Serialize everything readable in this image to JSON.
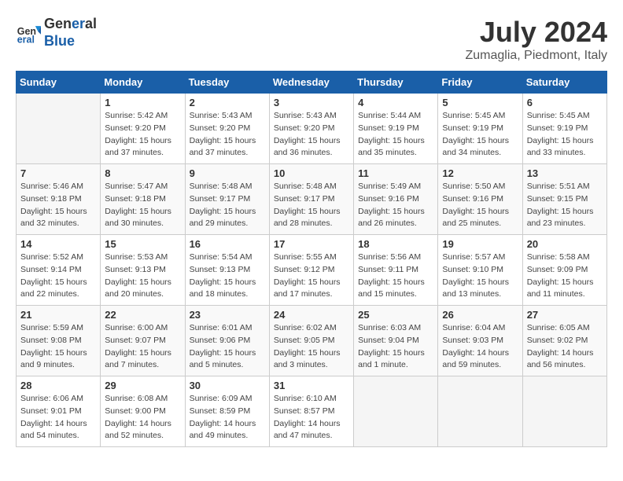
{
  "header": {
    "logo_line1": "General",
    "logo_line2": "Blue",
    "month_year": "July 2024",
    "location": "Zumaglia, Piedmont, Italy"
  },
  "weekdays": [
    "Sunday",
    "Monday",
    "Tuesday",
    "Wednesday",
    "Thursday",
    "Friday",
    "Saturday"
  ],
  "weeks": [
    [
      {
        "day": "",
        "info": ""
      },
      {
        "day": "1",
        "info": "Sunrise: 5:42 AM\nSunset: 9:20 PM\nDaylight: 15 hours\nand 37 minutes."
      },
      {
        "day": "2",
        "info": "Sunrise: 5:43 AM\nSunset: 9:20 PM\nDaylight: 15 hours\nand 37 minutes."
      },
      {
        "day": "3",
        "info": "Sunrise: 5:43 AM\nSunset: 9:20 PM\nDaylight: 15 hours\nand 36 minutes."
      },
      {
        "day": "4",
        "info": "Sunrise: 5:44 AM\nSunset: 9:19 PM\nDaylight: 15 hours\nand 35 minutes."
      },
      {
        "day": "5",
        "info": "Sunrise: 5:45 AM\nSunset: 9:19 PM\nDaylight: 15 hours\nand 34 minutes."
      },
      {
        "day": "6",
        "info": "Sunrise: 5:45 AM\nSunset: 9:19 PM\nDaylight: 15 hours\nand 33 minutes."
      }
    ],
    [
      {
        "day": "7",
        "info": "Sunrise: 5:46 AM\nSunset: 9:18 PM\nDaylight: 15 hours\nand 32 minutes."
      },
      {
        "day": "8",
        "info": "Sunrise: 5:47 AM\nSunset: 9:18 PM\nDaylight: 15 hours\nand 30 minutes."
      },
      {
        "day": "9",
        "info": "Sunrise: 5:48 AM\nSunset: 9:17 PM\nDaylight: 15 hours\nand 29 minutes."
      },
      {
        "day": "10",
        "info": "Sunrise: 5:48 AM\nSunset: 9:17 PM\nDaylight: 15 hours\nand 28 minutes."
      },
      {
        "day": "11",
        "info": "Sunrise: 5:49 AM\nSunset: 9:16 PM\nDaylight: 15 hours\nand 26 minutes."
      },
      {
        "day": "12",
        "info": "Sunrise: 5:50 AM\nSunset: 9:16 PM\nDaylight: 15 hours\nand 25 minutes."
      },
      {
        "day": "13",
        "info": "Sunrise: 5:51 AM\nSunset: 9:15 PM\nDaylight: 15 hours\nand 23 minutes."
      }
    ],
    [
      {
        "day": "14",
        "info": "Sunrise: 5:52 AM\nSunset: 9:14 PM\nDaylight: 15 hours\nand 22 minutes."
      },
      {
        "day": "15",
        "info": "Sunrise: 5:53 AM\nSunset: 9:13 PM\nDaylight: 15 hours\nand 20 minutes."
      },
      {
        "day": "16",
        "info": "Sunrise: 5:54 AM\nSunset: 9:13 PM\nDaylight: 15 hours\nand 18 minutes."
      },
      {
        "day": "17",
        "info": "Sunrise: 5:55 AM\nSunset: 9:12 PM\nDaylight: 15 hours\nand 17 minutes."
      },
      {
        "day": "18",
        "info": "Sunrise: 5:56 AM\nSunset: 9:11 PM\nDaylight: 15 hours\nand 15 minutes."
      },
      {
        "day": "19",
        "info": "Sunrise: 5:57 AM\nSunset: 9:10 PM\nDaylight: 15 hours\nand 13 minutes."
      },
      {
        "day": "20",
        "info": "Sunrise: 5:58 AM\nSunset: 9:09 PM\nDaylight: 15 hours\nand 11 minutes."
      }
    ],
    [
      {
        "day": "21",
        "info": "Sunrise: 5:59 AM\nSunset: 9:08 PM\nDaylight: 15 hours\nand 9 minutes."
      },
      {
        "day": "22",
        "info": "Sunrise: 6:00 AM\nSunset: 9:07 PM\nDaylight: 15 hours\nand 7 minutes."
      },
      {
        "day": "23",
        "info": "Sunrise: 6:01 AM\nSunset: 9:06 PM\nDaylight: 15 hours\nand 5 minutes."
      },
      {
        "day": "24",
        "info": "Sunrise: 6:02 AM\nSunset: 9:05 PM\nDaylight: 15 hours\nand 3 minutes."
      },
      {
        "day": "25",
        "info": "Sunrise: 6:03 AM\nSunset: 9:04 PM\nDaylight: 15 hours\nand 1 minute."
      },
      {
        "day": "26",
        "info": "Sunrise: 6:04 AM\nSunset: 9:03 PM\nDaylight: 14 hours\nand 59 minutes."
      },
      {
        "day": "27",
        "info": "Sunrise: 6:05 AM\nSunset: 9:02 PM\nDaylight: 14 hours\nand 56 minutes."
      }
    ],
    [
      {
        "day": "28",
        "info": "Sunrise: 6:06 AM\nSunset: 9:01 PM\nDaylight: 14 hours\nand 54 minutes."
      },
      {
        "day": "29",
        "info": "Sunrise: 6:08 AM\nSunset: 9:00 PM\nDaylight: 14 hours\nand 52 minutes."
      },
      {
        "day": "30",
        "info": "Sunrise: 6:09 AM\nSunset: 8:59 PM\nDaylight: 14 hours\nand 49 minutes."
      },
      {
        "day": "31",
        "info": "Sunrise: 6:10 AM\nSunset: 8:57 PM\nDaylight: 14 hours\nand 47 minutes."
      },
      {
        "day": "",
        "info": ""
      },
      {
        "day": "",
        "info": ""
      },
      {
        "day": "",
        "info": ""
      }
    ]
  ]
}
